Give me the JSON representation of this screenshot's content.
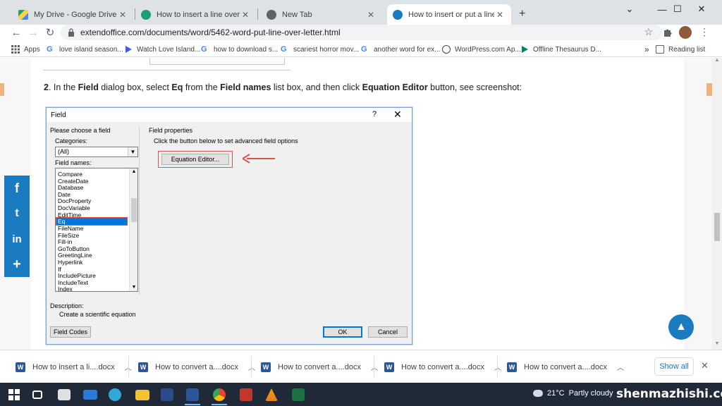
{
  "tabs": [
    {
      "title": "My Drive - Google Drive",
      "favicon_color": "#1fa463"
    },
    {
      "title": "How to insert a line over the top",
      "favicon_color": "#1b9e77"
    },
    {
      "title": "New Tab",
      "favicon_color": "#5f6368"
    },
    {
      "title": "How to insert or put a line over t",
      "favicon_color": "#1b7bc0"
    }
  ],
  "new_tab_symbol": "+",
  "window_controls": {
    "chevron": "⌄",
    "minimize": "—",
    "maximize": "☐",
    "close": "✕"
  },
  "toolbar": {
    "back": "←",
    "forward": "→",
    "reload": "↻",
    "url": "extendoffice.com/documents/word/5462-word-put-line-over-letter.html",
    "star": "☆",
    "menu": "⋮"
  },
  "bookmarks": [
    {
      "label": "Apps",
      "icon": "apps-grid-icon"
    },
    {
      "label": "love island season...",
      "icon": "google-icon"
    },
    {
      "label": "Watch Love Island...",
      "icon": "play-icon"
    },
    {
      "label": "how to download s...",
      "icon": "google-icon"
    },
    {
      "label": "scariest horror mov...",
      "icon": "google-icon"
    },
    {
      "label": "another word for ex...",
      "icon": "google-icon"
    },
    {
      "label": "WordPress.com Ap...",
      "icon": "wordpress-icon"
    },
    {
      "label": "Offline Thesaurus D...",
      "icon": "play-icon"
    }
  ],
  "bookmarks_overflow": "»",
  "reading_list": "Reading list",
  "instruction": {
    "step": "2",
    "p1": ". In the ",
    "b1": "Field",
    "p2": " dialog box, select ",
    "b2": "Eq",
    "p3": " from the ",
    "b3": "Field names",
    "p4": " list box, and then click ",
    "b4": "Equation Editor",
    "p5": " button, see screenshot:"
  },
  "share": {
    "facebook": "f",
    "twitter": "t",
    "linkedin": "in",
    "more": "+"
  },
  "dialog": {
    "title": "Field",
    "help": "?",
    "close": "✕",
    "left_heading": "Please choose a field",
    "categories_label": "Categories:",
    "categories_value": "(All)",
    "field_names_label": "Field names:",
    "field_names": [
      "Compare",
      "CreateDate",
      "Database",
      "Date",
      "DocProperty",
      "DocVariable",
      "EditTime",
      "Eq",
      "FileName",
      "FileSize",
      "Fill-in",
      "GoToButton",
      "GreetingLine",
      "Hyperlink",
      "If",
      "IncludePicture",
      "IncludeText",
      "Index"
    ],
    "selected_field": "Eq",
    "right_heading": "Field properties",
    "right_hint": "Click the button below to set advanced field options",
    "equation_button": "Equation Editor...",
    "description_label": "Description:",
    "description_text": "Create a scientific equation",
    "field_codes_button": "Field Codes",
    "ok_button": "OK",
    "cancel_button": "Cancel",
    "arrow_color": "#d9534f"
  },
  "back_to_top": "▲",
  "downloads": [
    {
      "name": "How to insert a li....docx"
    },
    {
      "name": "How to convert a....docx"
    },
    {
      "name": "How to convert a....docx"
    },
    {
      "name": "How to convert a....docx"
    },
    {
      "name": "How to convert a....docx"
    }
  ],
  "downloads_show_all": "Show all",
  "downloads_close": "✕",
  "taskbar": {
    "weather_temp": "21°C",
    "weather_desc": "Partly cloudy",
    "watermark": "shenmazhishi.com"
  },
  "colors": {
    "accent": "#1b7bc0",
    "highlight": "#d9534f"
  }
}
